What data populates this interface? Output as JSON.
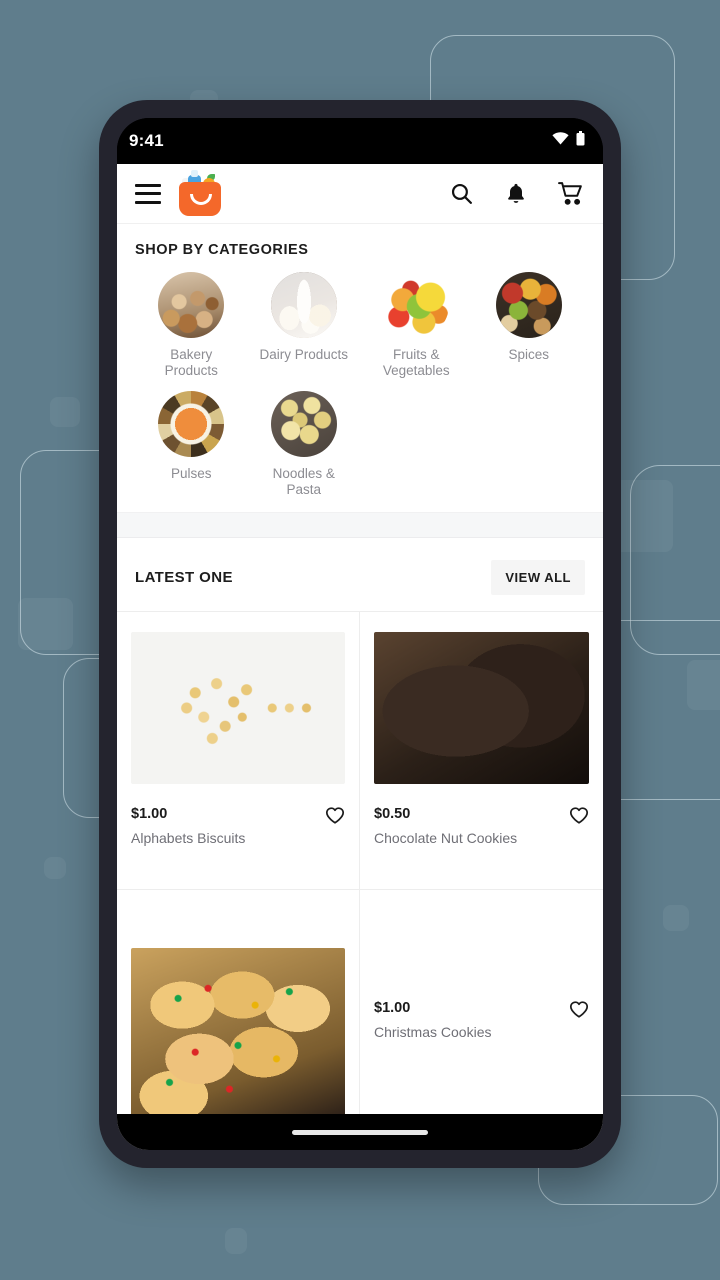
{
  "background": {
    "color": "#5f7d8c",
    "outline_color": "#dbebf0"
  },
  "status_bar": {
    "time": "9:41",
    "wifi_icon": "wifi-icon",
    "battery_icon": "battery-icon"
  },
  "app_bar": {
    "menu_icon": "hamburger-menu-icon",
    "logo": "shopping-bag-logo",
    "search_icon": "search-icon",
    "notifications_icon": "bell-icon",
    "cart_icon": "shopping-cart-icon"
  },
  "categories_section": {
    "title": "SHOP BY CATEGORIES",
    "items": [
      {
        "label": "Bakery Products",
        "image": "bakery-products-photo"
      },
      {
        "label": "Dairy Products",
        "image": "dairy-products-photo"
      },
      {
        "label": "Fruits & Vegetables",
        "image": "fruits-vegetables-photo"
      },
      {
        "label": "Spices",
        "image": "spices-photo"
      },
      {
        "label": "Pulses",
        "image": "pulses-photo"
      },
      {
        "label": "Noodles & Pasta",
        "image": "noodles-pasta-photo"
      }
    ]
  },
  "latest_section": {
    "title": "LATEST ONE",
    "view_all_label": "VIEW ALL",
    "products": [
      {
        "price": "$1.00",
        "name": "Alphabets Biscuits",
        "image": "alphabet-biscuits-photo",
        "favorite_icon": "heart-outline-icon"
      },
      {
        "price": "$0.50",
        "name": "Chocolate Nut Cookies",
        "image": "chocolate-nut-cookies-photo",
        "favorite_icon": "heart-outline-icon"
      },
      {
        "price": "$1.00",
        "name": "Christmas Cookies",
        "image": "christmas-cookies-photo",
        "favorite_icon": "heart-outline-icon"
      }
    ]
  },
  "system_nav": {
    "home_indicator": "home-indicator-bar"
  }
}
